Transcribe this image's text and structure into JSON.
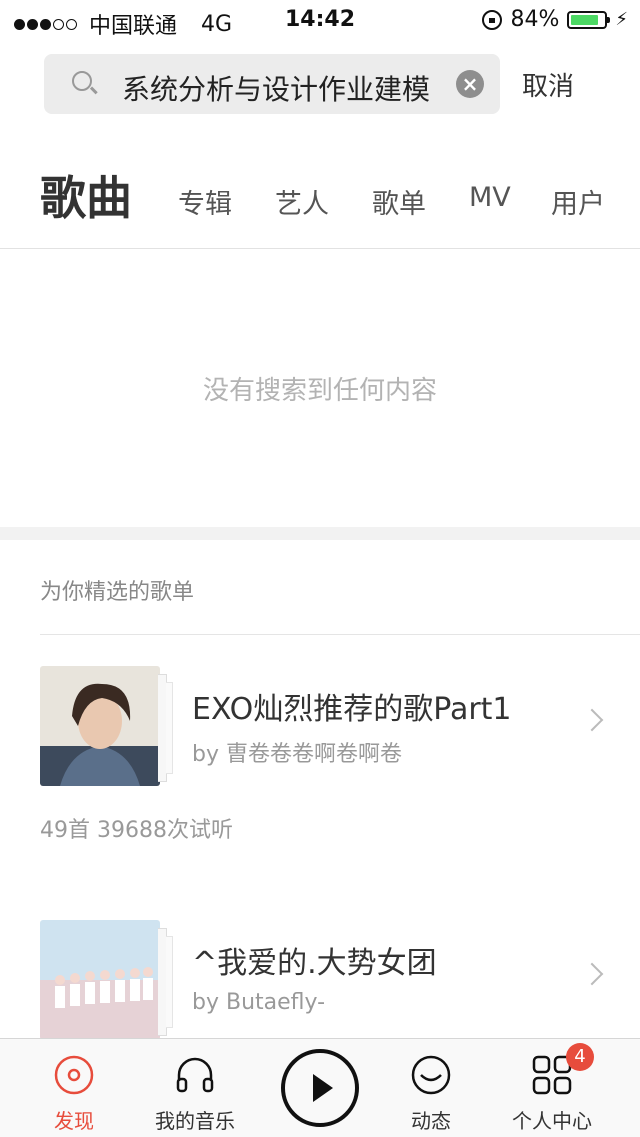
{
  "status_bar": {
    "carrier": "中国联通",
    "network": "4G",
    "time": "14:42",
    "battery": "84%",
    "battery_level": 0.84,
    "signal_bars_filled": 3,
    "signal_bars_total": 5
  },
  "search": {
    "query": "系统分析与设计作业建模",
    "cancel_label": "取消"
  },
  "tabs": [
    {
      "label": "歌曲",
      "active": true
    },
    {
      "label": "专辑",
      "active": false
    },
    {
      "label": "艺人",
      "active": false
    },
    {
      "label": "歌单",
      "active": false
    },
    {
      "label": "MV",
      "active": false
    },
    {
      "label": "用户",
      "active": false
    }
  ],
  "results": {
    "empty_message": "没有搜索到任何内容"
  },
  "recommended": {
    "section_title": "为你精选的歌单",
    "playlists": [
      {
        "title": "EXO灿烈推荐的歌Part1",
        "by": "by 曺卷卷卷啊卷啊卷",
        "stats": "49首 39688次试听"
      },
      {
        "title": "^我爱的.大势女团",
        "by": "by Butaefly-"
      }
    ]
  },
  "tab_bar": {
    "items": [
      {
        "label": "发现",
        "icon": "discover-icon",
        "active": true
      },
      {
        "label": "我的音乐",
        "icon": "headphones-icon",
        "active": false
      },
      {
        "label": "",
        "icon": "play-icon",
        "active": false
      },
      {
        "label": "动态",
        "icon": "smile-icon",
        "active": false
      },
      {
        "label": "个人中心",
        "icon": "grid-icon",
        "active": false
      }
    ],
    "badge": "4"
  },
  "colors": {
    "accent": "#e74c3c",
    "battery": "#4cd964"
  }
}
